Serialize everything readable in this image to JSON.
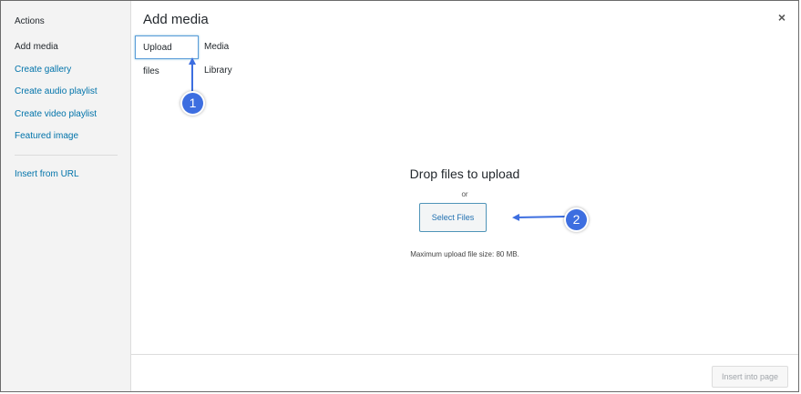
{
  "sidebar": {
    "heading": "Actions",
    "items": [
      {
        "label": "Add media",
        "active": true
      },
      {
        "label": "Create gallery",
        "active": false
      },
      {
        "label": "Create audio playlist",
        "active": false
      },
      {
        "label": "Create video playlist",
        "active": false
      },
      {
        "label": "Featured image",
        "active": false
      }
    ],
    "extra_item": "Insert from URL"
  },
  "header": {
    "title": "Add media",
    "close_glyph": "×"
  },
  "tabs": [
    {
      "label": "Upload files",
      "active": true
    },
    {
      "label": "Media Library",
      "active": false
    }
  ],
  "upload": {
    "drop_title": "Drop files to upload",
    "or_text": "or",
    "select_button": "Select Files",
    "max_size": "Maximum upload file size: 80 MB."
  },
  "footer": {
    "insert_button": "Insert into page"
  },
  "annotations": [
    {
      "number": "1",
      "target": "Upload files tab"
    },
    {
      "number": "2",
      "target": "Select Files button"
    }
  ],
  "colors": {
    "link": "#0073aa",
    "annotation": "#3d6ee0",
    "active_tab_border": "#5b9dd9"
  }
}
